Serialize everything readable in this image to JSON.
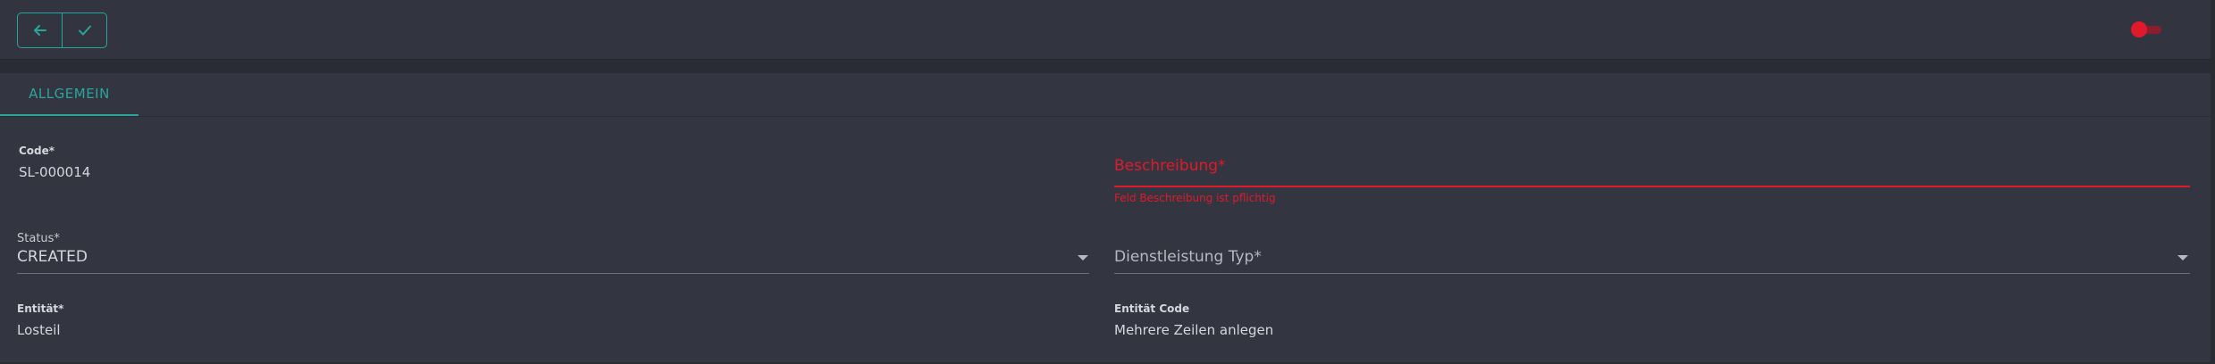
{
  "toolbar": {
    "back_icon": "arrow-left-icon",
    "confirm_icon": "check-icon",
    "accent_color": "#2aa59b",
    "toggle_color": "#e01a2a"
  },
  "tabs": [
    {
      "label": "ALLGEMEIN",
      "active": true
    }
  ],
  "form": {
    "code": {
      "label": "Code*",
      "value": "SL-000014"
    },
    "beschreibung": {
      "placeholder": "Beschreibung*",
      "value": "",
      "error": "Feld Beschreibung ist pflichtig",
      "error_color": "#e01a2a"
    },
    "status": {
      "label": "Status*",
      "value": "CREATED"
    },
    "dienstleistung_typ": {
      "placeholder": "Dienstleistung Typ*",
      "value": ""
    },
    "entitaet": {
      "label": "Entität*",
      "value": "Losteil"
    },
    "entitaet_code": {
      "label": "Entität Code",
      "value": "Mehrere Zeilen anlegen"
    }
  }
}
